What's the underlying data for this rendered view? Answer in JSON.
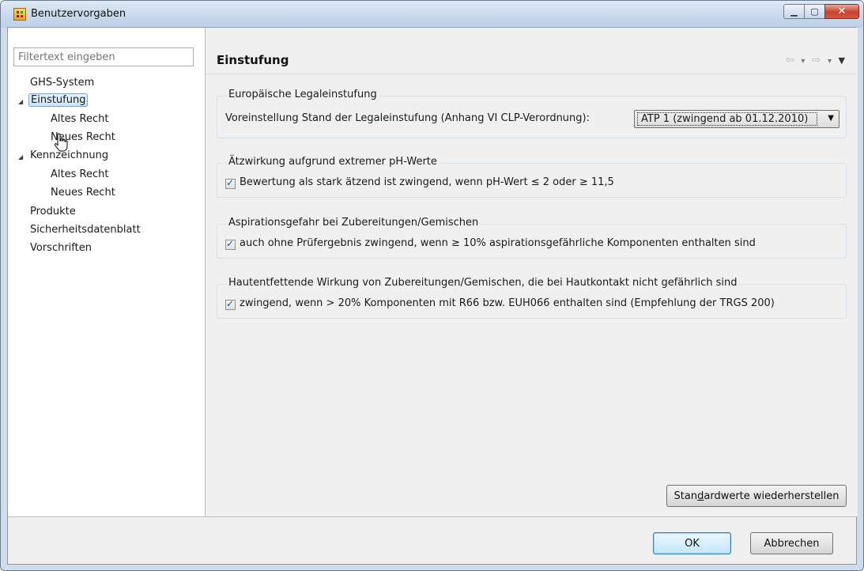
{
  "window": {
    "title": "Benutzervorgaben",
    "controls": {
      "minimize": "▁",
      "maximize": "▢",
      "close": "✕"
    }
  },
  "sidebar": {
    "filter_placeholder": "Filtertext eingeben",
    "tree": [
      {
        "label": "GHS-System",
        "level": 0,
        "expanded": null
      },
      {
        "label": "Einstufung",
        "level": 0,
        "expanded": true,
        "selected": true
      },
      {
        "label": "Altes Recht",
        "level": 1
      },
      {
        "label": "Neues Recht",
        "level": 1
      },
      {
        "label": "Kennzeichnung",
        "level": 0,
        "expanded": true
      },
      {
        "label": "Altes Recht",
        "level": 1
      },
      {
        "label": "Neues Recht",
        "level": 1
      },
      {
        "label": "Produkte",
        "level": 0
      },
      {
        "label": "Sicherheitsdatenblatt",
        "level": 0
      },
      {
        "label": "Vorschriften",
        "level": 0
      }
    ]
  },
  "page": {
    "title": "Einstufung",
    "nav": {
      "back": "⇦",
      "forward": "⇨",
      "dropdown": "▾",
      "menu": "▼"
    }
  },
  "groups": [
    {
      "label": "Europäische Legaleinstufung",
      "text": "Voreinstellung Stand der Legaleinstufung (Anhang VI CLP-Verordnung):",
      "select_value": "ATP 1 (zwingend ab 01.12.2010)"
    },
    {
      "label": "Ätzwirkung aufgrund extremer pH-Werte",
      "checkbox_label": "Bewertung als stark ätzend ist zwingend, wenn pH-Wert ≤ 2 oder ≥ 11,5",
      "checked": true
    },
    {
      "label": "Aspirationsgefahr bei Zubereitungen/Gemischen",
      "checkbox_label": "auch ohne Prüfergebnis zwingend, wenn ≥ 10% aspirationsgefährliche Komponenten enthalten sind",
      "checked": true
    },
    {
      "label": "Hautentfettende Wirkung von Zubereitungen/Gemischen, die bei Hautkontakt nicht gefährlich sind",
      "checkbox_label": "zwingend, wenn > 20% Komponenten mit R66 bzw. EUH066 enthalten sind (Empfehlung der TRGS 200)",
      "checked": true
    }
  ],
  "buttons": {
    "restore_defaults_pre": "Stan",
    "restore_defaults_mnemonic": "d",
    "restore_defaults_post": "ardwerte wiederherstellen",
    "ok": "OK",
    "cancel": "Abbrechen"
  }
}
